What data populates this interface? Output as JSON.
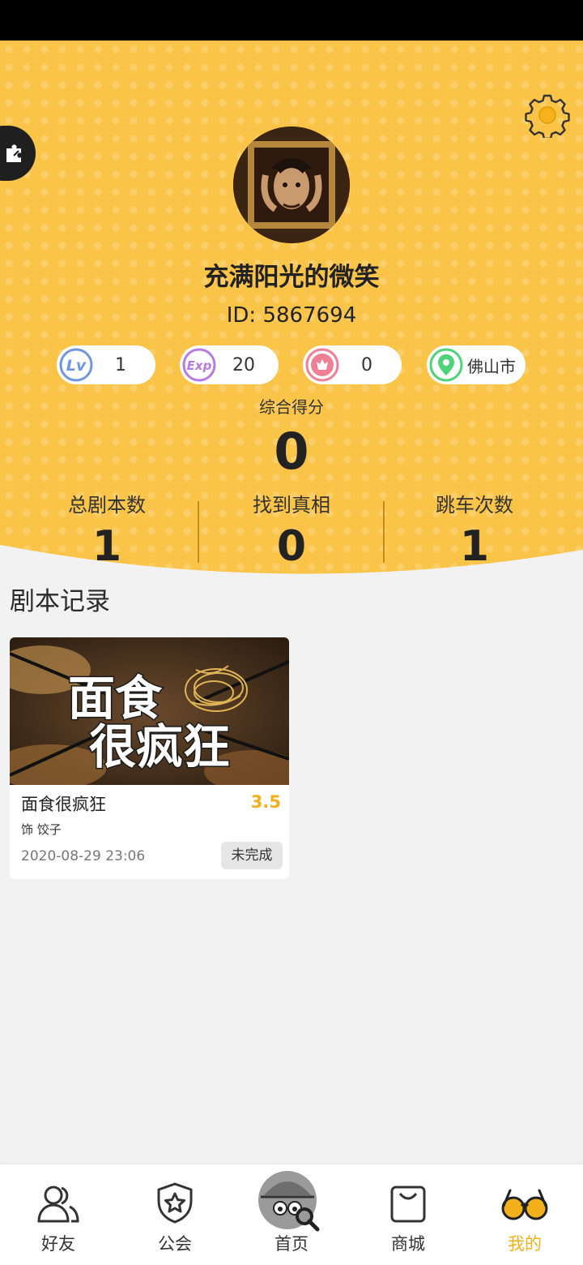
{
  "profile": {
    "username": "充满阳光的微笑",
    "id_text": "ID: 5867694",
    "stats_pills": [
      {
        "icon": "lv-icon",
        "value": "1"
      },
      {
        "icon": "exp-icon",
        "value": "20"
      },
      {
        "icon": "flower-icon",
        "value": "0"
      },
      {
        "icon": "location-pin-icon",
        "value": "佛山市"
      }
    ],
    "score_label": "综合得分",
    "score_value": "0",
    "stats": [
      {
        "label": "总剧本数",
        "value": "1"
      },
      {
        "label": "找到真相",
        "value": "0"
      },
      {
        "label": "跳车次数",
        "value": "1"
      }
    ]
  },
  "records": {
    "title": "剧本记录",
    "items": [
      {
        "cover_text_line1": "面食",
        "cover_text_line2": "很疯狂",
        "name": "面食很疯狂",
        "rating": "3.5",
        "role": "饰 饺子",
        "datetime": "2020-08-29   23:06",
        "status": "未完成"
      }
    ]
  },
  "nav": {
    "items": [
      {
        "label": "好友"
      },
      {
        "label": "公会"
      },
      {
        "label": "首页"
      },
      {
        "label": "商城"
      },
      {
        "label": "我的"
      }
    ],
    "active_index": 4
  },
  "colors": {
    "header_bg": "#f9c448",
    "accent": "#f2b11b",
    "page_bg": "#f2f2f2"
  }
}
